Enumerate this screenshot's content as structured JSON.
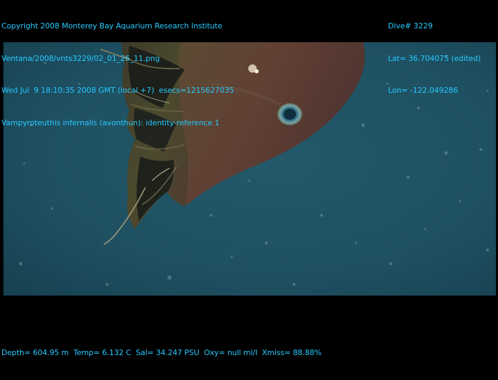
{
  "overlay_top_left": {
    "copyright": "Copyright 2008 Monterey Bay Aquarium Research Institute",
    "file_path": "Ventana/2008/vnts3229/02_01_26_11.png",
    "timestamp": "Wed Jul  9 18:10:35 2008 GMT (local +7)  esecs=1215627035",
    "species": "Vampyroteuthis infernalis (avonthun): identity-reference 1"
  },
  "overlay_top_right": {
    "dive": "Dive# 3229",
    "lat": "Lat= 36.704075 (edited)",
    "lon": "Lon= -122.049286"
  },
  "overlay_bottom": {
    "telemetry": "Depth= 604.95 m  Temp= 6.132 C  Sal= 34.247 PSU  Oxy= null ml/l  Xmiss= 88.88%"
  },
  "colors": {
    "overlay_text": "#27c9ff",
    "water": "#1f5263",
    "animal_body": "#5a3e33",
    "animal_web": "#4a4a2c"
  }
}
